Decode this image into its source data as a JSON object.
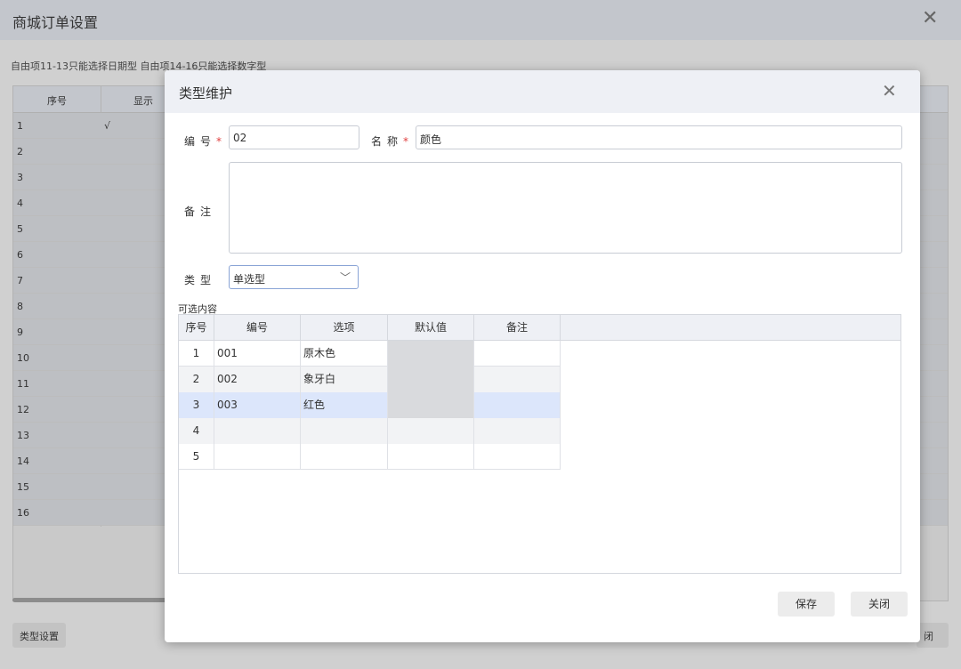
{
  "background": {
    "title": "商城订单设置",
    "hint": "自由项11-13只能选择日期型 自由项14-16只能选择数字型",
    "columns": [
      "序号",
      "显示"
    ],
    "rows": [
      {
        "n": "1",
        "v": "√"
      },
      {
        "n": "2",
        "v": ""
      },
      {
        "n": "3",
        "v": ""
      },
      {
        "n": "4",
        "v": ""
      },
      {
        "n": "5",
        "v": ""
      },
      {
        "n": "6",
        "v": ""
      },
      {
        "n": "7",
        "v": ""
      },
      {
        "n": "8",
        "v": ""
      },
      {
        "n": "9",
        "v": ""
      },
      {
        "n": "10",
        "v": ""
      },
      {
        "n": "11",
        "v": ""
      },
      {
        "n": "12",
        "v": ""
      },
      {
        "n": "13",
        "v": ""
      },
      {
        "n": "14",
        "v": ""
      },
      {
        "n": "15",
        "v": ""
      },
      {
        "n": "16",
        "v": ""
      }
    ],
    "type_settings_button": "类型设置",
    "close_button_partial": "闭"
  },
  "modal": {
    "title": "类型维护",
    "code_label": "编号",
    "code_value": "02",
    "name_label": "名称",
    "name_value": "颜色",
    "remark_label": "备注",
    "type_label": "类型",
    "type_value": "单选型",
    "options_label": "可选内容",
    "grid": {
      "headers": [
        "序号",
        "编号",
        "选项",
        "默认值",
        "备注"
      ],
      "rows": [
        {
          "idx": "1",
          "code": "001",
          "option": "原木色",
          "default": "",
          "remark": ""
        },
        {
          "idx": "2",
          "code": "002",
          "option": "象牙白",
          "default": "",
          "remark": ""
        },
        {
          "idx": "3",
          "code": "003",
          "option": "红色",
          "default": "",
          "remark": ""
        },
        {
          "idx": "4",
          "code": "",
          "option": "",
          "default": "",
          "remark": ""
        },
        {
          "idx": "5",
          "code": "",
          "option": "",
          "default": "",
          "remark": ""
        }
      ]
    },
    "save_button": "保存",
    "close_button": "关闭"
  },
  "icons": {
    "close": "close-icon",
    "dropdown": "chevron-down-icon"
  },
  "colors": {
    "selected_row": "#dce6fb",
    "required": "#e04040",
    "header_bg": "#eef0f5"
  }
}
